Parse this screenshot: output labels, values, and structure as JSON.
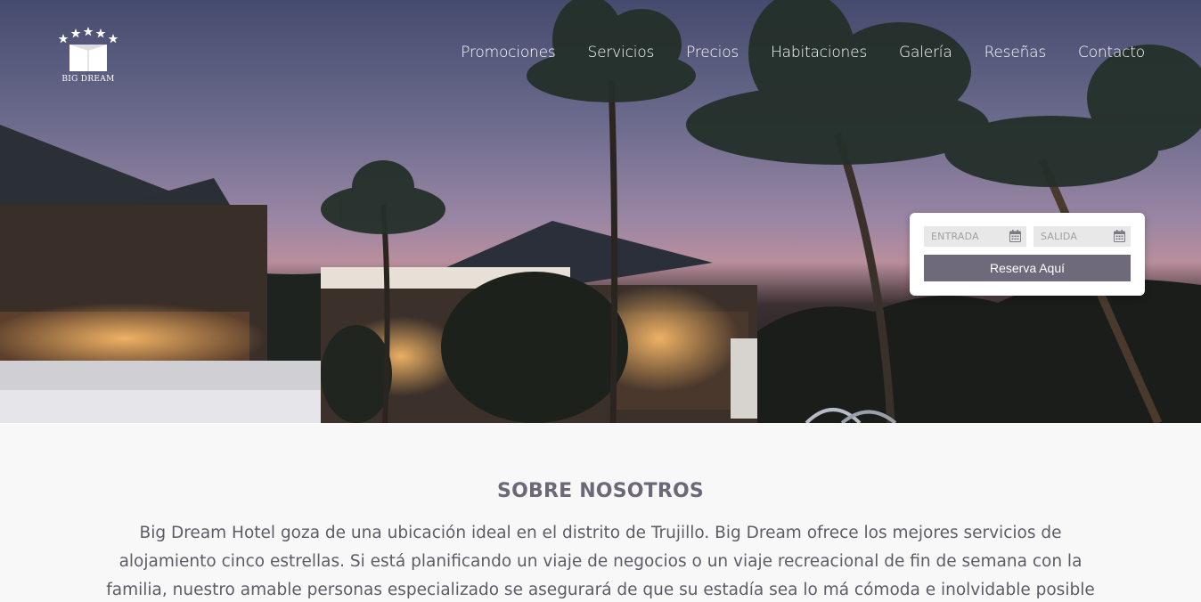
{
  "brand": {
    "logo_text": "BIG DREAM"
  },
  "nav": {
    "items": [
      {
        "label": "Promociones"
      },
      {
        "label": "Servicios"
      },
      {
        "label": "Precios"
      },
      {
        "label": "Habitaciones"
      },
      {
        "label": "Galería"
      },
      {
        "label": "Reseñas"
      },
      {
        "label": "Contacto"
      }
    ]
  },
  "booking": {
    "checkin_placeholder": "ENTRADA",
    "checkout_placeholder": "SALIDA",
    "button_label": "Reserva Aquí"
  },
  "about": {
    "title": "SOBRE NOSOTROS",
    "text": "Big Dream Hotel goza de una ubicación ideal en el distrito de Trujillo. Big Dream ofrece los mejores servicios de alojamiento cinco estrellas. Si está planificando un viaje de negocios o un viaje recreacional de fin de semana con la familia, nuestro amable personas especializado se asegurará de que su estadía sea lo má cómoda e inolvidable posible"
  },
  "colors": {
    "accent": "#6e6a7c",
    "heading": "#6c6878",
    "body_text": "#5f5b66",
    "page_bg": "#f8f8f8"
  }
}
